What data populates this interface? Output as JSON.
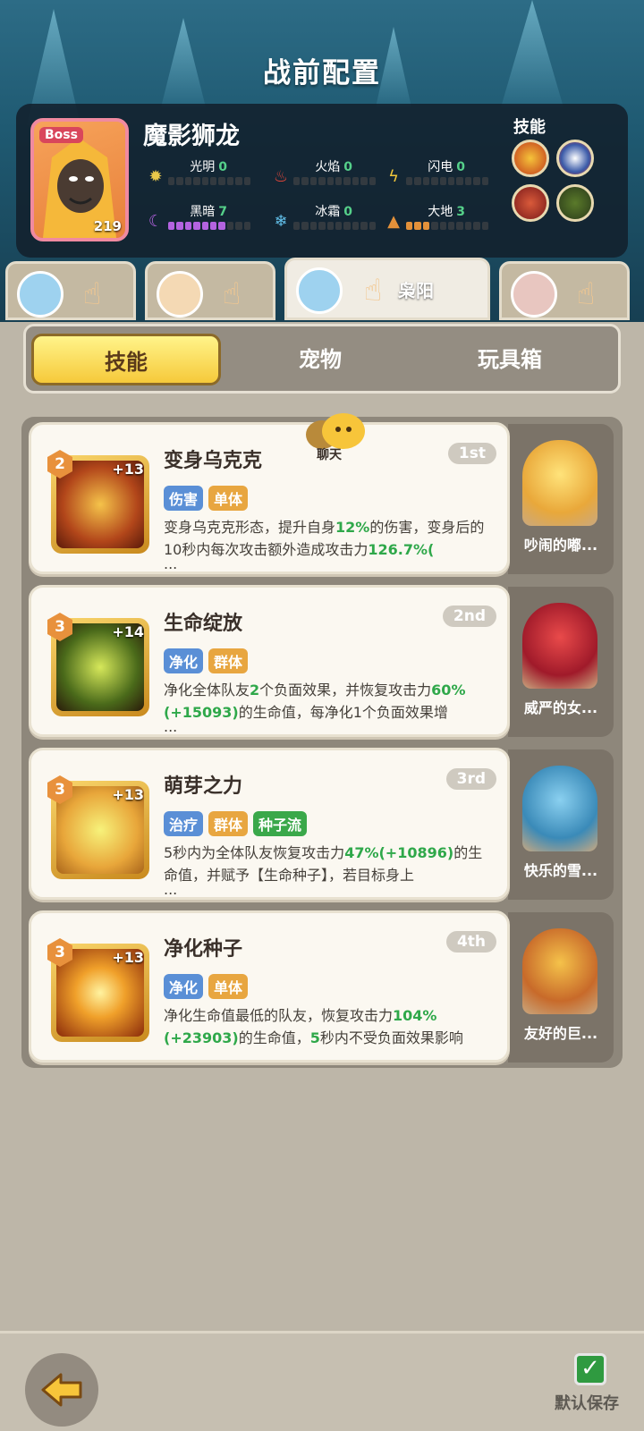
{
  "header": {
    "title": "战前配置"
  },
  "boss": {
    "tag": "Boss",
    "name": "魔影狮龙",
    "level": "219",
    "skills_label": "技能",
    "elements": [
      {
        "name": "光明",
        "value": "0",
        "icon": "sun-icon",
        "filled": 0,
        "color": "#e9c84a"
      },
      {
        "name": "火焰",
        "value": "0",
        "icon": "flame-icon",
        "filled": 0,
        "color": "#e4463a"
      },
      {
        "name": "闪电",
        "value": "0",
        "icon": "lightning-icon",
        "filled": 0,
        "color": "#f1c63a"
      },
      {
        "name": "黑暗",
        "value": "7",
        "icon": "moon-icon",
        "filled": 7,
        "color": "#b463e0"
      },
      {
        "name": "冰霜",
        "value": "0",
        "icon": "snowflake-icon",
        "filled": 0,
        "color": "#62c0ea"
      },
      {
        "name": "大地",
        "value": "3",
        "icon": "mountain-icon",
        "filled": 3,
        "color": "#e3913a"
      }
    ]
  },
  "hero_tabs": [
    {
      "name": ""
    },
    {
      "name": ""
    },
    {
      "name": "枭阳"
    },
    {
      "name": ""
    }
  ],
  "segment_tabs": {
    "skills": "技能",
    "pets": "宠物",
    "toybox": "玩具箱"
  },
  "chat_label": "聊天",
  "skills": [
    {
      "level": "2",
      "plus": "+13",
      "name": "变身乌克克",
      "rank": "1st",
      "tags": [
        "伤害",
        "单体"
      ],
      "desc": [
        "变身乌克克形态，提升自身",
        "12%",
        "的伤害，变身后的10秒内每次攻击额外造成攻击力",
        "126.7%("
      ],
      "more": "...",
      "pet": "吵闹的嘟..."
    },
    {
      "level": "3",
      "plus": "+14",
      "name": "生命绽放",
      "rank": "2nd",
      "tags": [
        "净化",
        "群体"
      ],
      "desc": [
        "净化全体队友",
        "2",
        "个负面效果，并恢复攻击力",
        "60%(+15093)",
        "的生命值，每净化1个负面效果增"
      ],
      "more": "...",
      "pet": "威严的女..."
    },
    {
      "level": "3",
      "plus": "+13",
      "name": "萌芽之力",
      "rank": "3rd",
      "tags": [
        "治疗",
        "群体",
        "种子流"
      ],
      "desc": [
        "5秒内为全体队友恢复攻击力",
        "47%(+10896)",
        "的生命值，并赋予【生命种子】，若目标身上"
      ],
      "more": "...",
      "pet": "快乐的雪..."
    },
    {
      "level": "3",
      "plus": "+13",
      "name": "净化种子",
      "rank": "4th",
      "tags": [
        "净化",
        "单体"
      ],
      "desc": [
        "净化生命值最低的队友，恢复攻击力",
        "104%(+23903)",
        "的生命值，",
        "5",
        "秒内不受负面效果影响"
      ],
      "more": "",
      "pet": "友好的巨..."
    }
  ],
  "footer": {
    "save_label": "默认保存"
  }
}
